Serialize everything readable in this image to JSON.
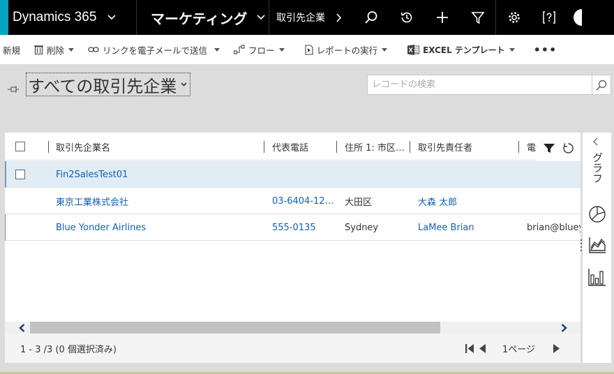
{
  "topnav": {
    "brand": "Dynamics 365",
    "area": "マーケティング",
    "entity": "取引先企業",
    "icons": [
      "search-icon",
      "history-icon",
      "plus-icon",
      "filter-icon",
      "gear-icon",
      "help-icon"
    ],
    "accent_color": "#00a3c4"
  },
  "cmdbar": {
    "new_label": "新規",
    "delete_label": "削除",
    "email_link_label": "リンクを電子メールで送信",
    "flow_label": "フロー",
    "report_label": "レポートの実行",
    "excel_label": "EXCEL テンプレート",
    "more_label": "•••"
  },
  "view": {
    "title": "すべての取引先企業",
    "search_placeholder": "レコードの検索"
  },
  "grid": {
    "columns": [
      "取引先企業名",
      "代表電話",
      "住所 1: 市区…",
      "取引先責任者",
      "電子"
    ],
    "rows": [
      {
        "name": "Fin2SalesTest01",
        "phone": "",
        "city": "",
        "contact": "",
        "email": ""
      },
      {
        "name": "東京工業株式会社",
        "phone": "03-6404-12…",
        "city": "大田区",
        "contact": "大森 太郎",
        "email": ""
      },
      {
        "name": "Blue Yonder Airlines",
        "phone": "555-0135",
        "city": "Sydney",
        "contact": "LaMee Brian",
        "email": "brian@bluey"
      }
    ],
    "footer_count": "1 - 3 /3 (0 個選択済み)",
    "page_label": "1ページ",
    "link_color": "#1160b7"
  },
  "chartpane": {
    "label": "グラフ"
  }
}
